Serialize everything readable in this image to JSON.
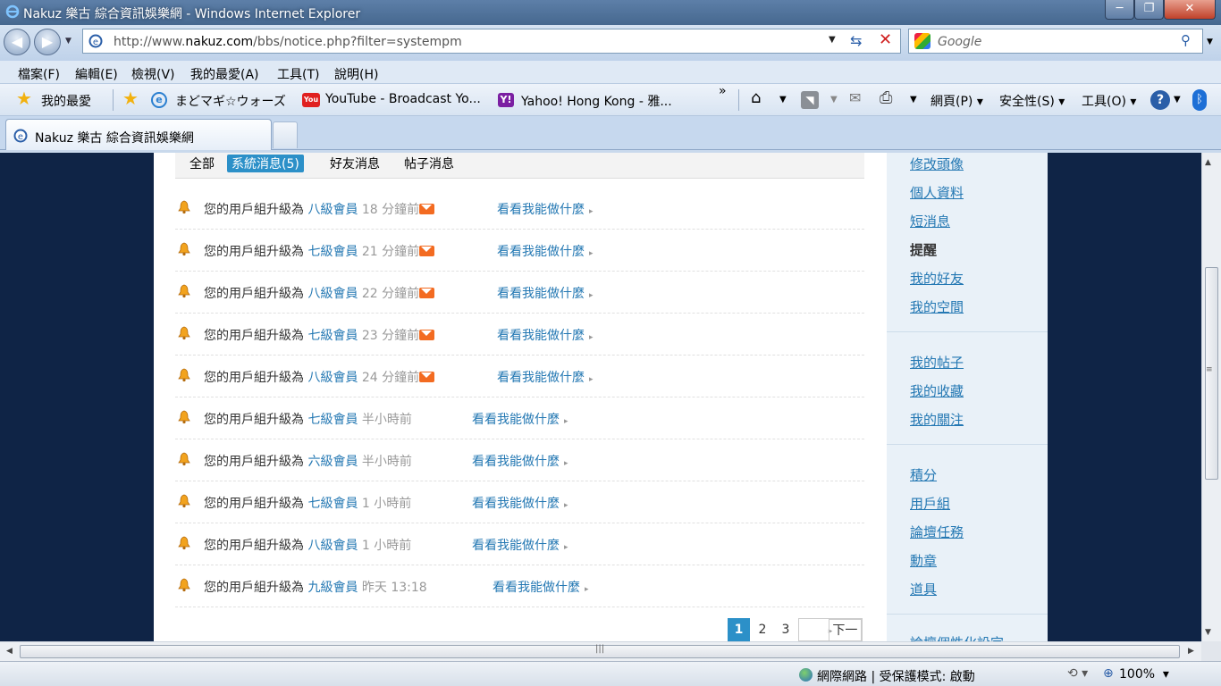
{
  "window": {
    "title": "Nakuz 樂古 綜合資訊娛樂網 - Windows Internet Explorer",
    "controls": {
      "min": "─",
      "max": "❐",
      "close": "✕"
    }
  },
  "address": {
    "url_prefix": "http://www.",
    "url_domain": "nakuz.com",
    "url_path": "/bbs/notice.php?filter=systempm",
    "search_placeholder": "Google"
  },
  "menu": [
    "檔案(F)",
    "編輯(E)",
    "檢視(V)",
    "我的最愛(A)",
    "工具(T)",
    "說明(H)"
  ],
  "favorites": {
    "button": "我的最愛",
    "items": [
      {
        "label": "まどマギ☆ウォーズ",
        "icon": "ie-page-icon"
      },
      {
        "label": "YouTube - Broadcast Yo...",
        "icon": "youtube-icon"
      },
      {
        "label": "Yahoo! Hong Kong - 雅...",
        "icon": "yahoo-icon"
      }
    ],
    "chevron": "»",
    "tools": [
      "網頁(P)",
      "安全性(S)",
      "工具(O)"
    ]
  },
  "tab": {
    "label": "Nakuz 樂古 綜合資訊娛樂網"
  },
  "filter_tabs": {
    "all": "全部",
    "system": "系統消息(5)",
    "friend": "好友消息",
    "post": "帖子消息"
  },
  "notices": [
    {
      "text": "您的用戶組升級為 ",
      "group": "八級會員",
      "time": " 18 分鐘前",
      "new": true,
      "link": "看看我能做什麼"
    },
    {
      "text": "您的用戶組升級為 ",
      "group": "七級會員",
      "time": " 21 分鐘前",
      "new": true,
      "link": "看看我能做什麼"
    },
    {
      "text": "您的用戶組升級為 ",
      "group": "八級會員",
      "time": " 22 分鐘前",
      "new": true,
      "link": "看看我能做什麼"
    },
    {
      "text": "您的用戶組升級為 ",
      "group": "七級會員",
      "time": " 23 分鐘前",
      "new": true,
      "link": "看看我能做什麼"
    },
    {
      "text": "您的用戶組升級為 ",
      "group": "八級會員",
      "time": " 24 分鐘前",
      "new": true,
      "link": "看看我能做什麼"
    },
    {
      "text": "您的用戶組升級為 ",
      "group": "七級會員",
      "time": " 半小時前",
      "new": false,
      "link": "看看我能做什麼"
    },
    {
      "text": "您的用戶組升級為 ",
      "group": "六級會員",
      "time": " 半小時前",
      "new": false,
      "link": "看看我能做什麼"
    },
    {
      "text": "您的用戶組升級為 ",
      "group": "七級會員",
      "time": " 1 小時前",
      "new": false,
      "link": "看看我能做什麼"
    },
    {
      "text": "您的用戶組升級為 ",
      "group": "八級會員",
      "time": " 1 小時前",
      "new": false,
      "link": "看看我能做什麼"
    },
    {
      "text": "您的用戶組升級為 ",
      "group": "九級會員",
      "time": " 昨天 13:18",
      "new": false,
      "link": "看看我能做什麼"
    }
  ],
  "pager": {
    "pages": [
      "1",
      "2",
      "3"
    ],
    "current": "1",
    "next": "下一頁"
  },
  "sidebar": {
    "group1": [
      "修改頭像",
      "個人資料",
      "短消息",
      "提醒",
      "我的好友",
      "我的空間"
    ],
    "group2": [
      "我的帖子",
      "我的收藏",
      "我的關注"
    ],
    "group3": [
      "積分",
      "用戶組",
      "論壇任務",
      "勳章",
      "道具"
    ],
    "group4_partial": "論壇個性化設定"
  },
  "status": {
    "zone": "網際網路 | 受保護模式: 啟動",
    "zoom": "100%"
  }
}
